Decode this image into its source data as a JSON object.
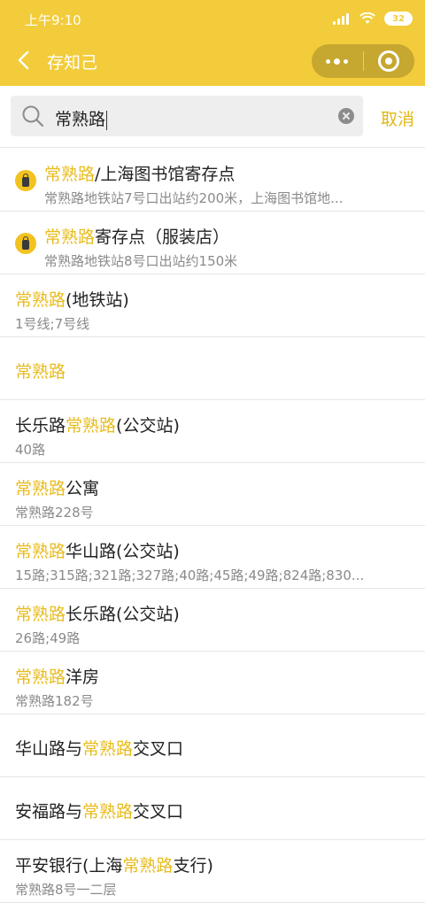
{
  "status": {
    "time": "上午9:10",
    "battery": "32"
  },
  "titlebar": {
    "title": "存知己"
  },
  "search": {
    "query": "常熟路",
    "cancel": "取消"
  },
  "results": [
    {
      "icon": "store-icon",
      "title": [
        [
          "常熟路",
          true
        ],
        [
          "/上海图书馆寄存点",
          false
        ]
      ],
      "sub": "常熟路地铁站7号口出站约200米，上海图书馆地..."
    },
    {
      "icon": "store-icon",
      "title": [
        [
          "常熟路",
          true
        ],
        [
          "寄存点（服装店）",
          false
        ]
      ],
      "sub": "常熟路地铁站8号口出站约150米"
    },
    {
      "title": [
        [
          "常熟路",
          true
        ],
        [
          "(地铁站)",
          false
        ]
      ],
      "sub": "1号线;7号线"
    },
    {
      "title": [
        [
          "常熟路",
          true
        ]
      ]
    },
    {
      "title": [
        [
          "长乐路",
          false
        ],
        [
          "常熟路",
          true
        ],
        [
          "(公交站)",
          false
        ]
      ],
      "sub": "40路"
    },
    {
      "title": [
        [
          "常熟路",
          true
        ],
        [
          "公寓",
          false
        ]
      ],
      "sub": "常熟路228号"
    },
    {
      "title": [
        [
          "常熟路",
          true
        ],
        [
          "华山路(公交站)",
          false
        ]
      ],
      "sub": "15路;315路;321路;327路;40路;45路;49路;824路;830..."
    },
    {
      "title": [
        [
          "常熟路",
          true
        ],
        [
          "长乐路(公交站)",
          false
        ]
      ],
      "sub": "26路;49路"
    },
    {
      "title": [
        [
          "常熟路",
          true
        ],
        [
          "洋房",
          false
        ]
      ],
      "sub": "常熟路182号"
    },
    {
      "title": [
        [
          "华山路与",
          false
        ],
        [
          "常熟路",
          true
        ],
        [
          "交叉口",
          false
        ]
      ]
    },
    {
      "title": [
        [
          "安福路与",
          false
        ],
        [
          "常熟路",
          true
        ],
        [
          "交叉口",
          false
        ]
      ]
    },
    {
      "title": [
        [
          "平安银行(上海",
          false
        ],
        [
          "常熟路",
          true
        ],
        [
          "支行)",
          false
        ]
      ],
      "sub": "常熟路8号一二层"
    }
  ]
}
